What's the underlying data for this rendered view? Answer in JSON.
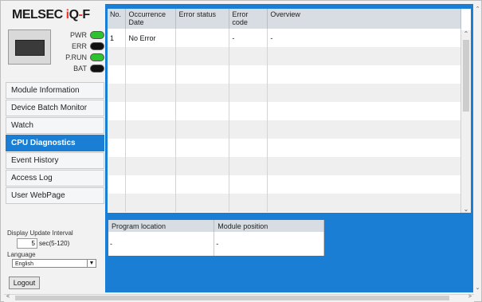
{
  "logo": {
    "prefix": "MELSEC ",
    "i": "i",
    "q": "Q",
    "dash": "-",
    "f": "F"
  },
  "leds": [
    {
      "label": "PWR",
      "color": "green"
    },
    {
      "label": "ERR",
      "color": "black"
    },
    {
      "label": "P.RUN",
      "color": "green"
    },
    {
      "label": "BAT",
      "color": "black"
    }
  ],
  "menu": [
    {
      "label": "Module Information",
      "active": false
    },
    {
      "label": "Device Batch Monitor",
      "active": false
    },
    {
      "label": "Watch",
      "active": false
    },
    {
      "label": "CPU Diagnostics",
      "active": true
    },
    {
      "label": "Event History",
      "active": false
    },
    {
      "label": "Access Log",
      "active": false
    },
    {
      "label": "User WebPage",
      "active": false
    }
  ],
  "update": {
    "label": "Display Update Interval",
    "value": "5",
    "unit": "sec(5-120)"
  },
  "language": {
    "label": "Language",
    "selected": "English"
  },
  "logout_label": "Logout",
  "error_table": {
    "headers": [
      "No.",
      "Occurrence Date",
      "Error status",
      "Error code",
      "Overview"
    ],
    "rows": [
      [
        "1",
        "No Error",
        "",
        "-",
        "-"
      ]
    ]
  },
  "location_table": {
    "headers": [
      "Program location",
      "Module position"
    ],
    "rows": [
      [
        "-",
        "-"
      ]
    ]
  },
  "colors": {
    "accent": "#1a7fd4",
    "led_green": "#2ec22e"
  }
}
